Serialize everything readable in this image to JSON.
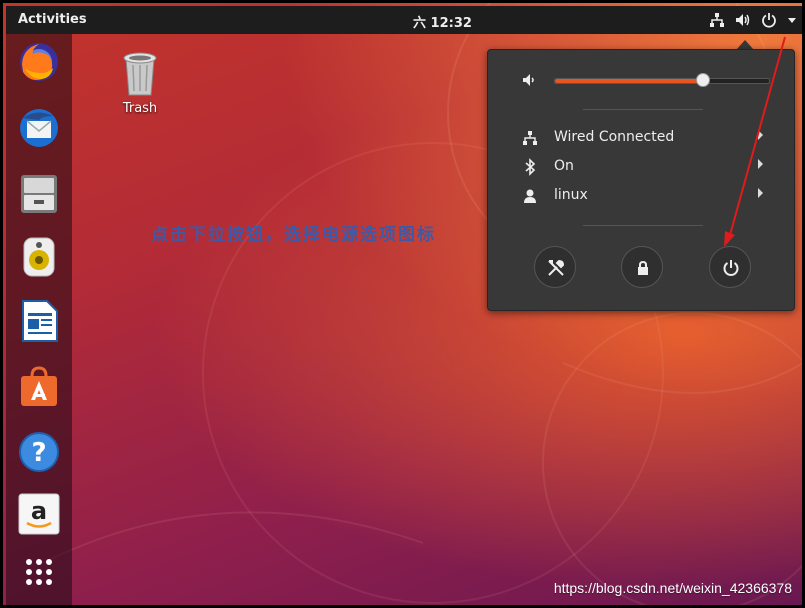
{
  "topbar": {
    "activities_label": "Activities",
    "clock": "六 12:32",
    "tray_icons": [
      "network-icon",
      "volume-icon",
      "power-icon",
      "dropdown-arrow-icon"
    ]
  },
  "dock": {
    "apps": [
      {
        "name": "Firefox",
        "icon": "firefox-icon"
      },
      {
        "name": "Thunderbird",
        "icon": "thunderbird-icon"
      },
      {
        "name": "Files",
        "icon": "files-icon"
      },
      {
        "name": "Rhythmbox",
        "icon": "rhythmbox-icon"
      },
      {
        "name": "LibreOffice Writer",
        "icon": "writer-icon"
      },
      {
        "name": "Ubuntu Software",
        "icon": "software-icon"
      },
      {
        "name": "Help",
        "icon": "help-icon"
      },
      {
        "name": "Amazon",
        "icon": "amazon-icon"
      },
      {
        "name": "Show Applications",
        "icon": "app-grid-icon"
      }
    ]
  },
  "desktop": {
    "trash_label": "Trash",
    "annotation_text": "点击下拉按钮，选择电源选项图标"
  },
  "system_menu": {
    "volume_level": 0.69,
    "items": [
      {
        "label": "Wired Connected",
        "icon": "wired-network-icon"
      },
      {
        "label": "On",
        "icon": "bluetooth-icon"
      },
      {
        "label": "linux",
        "icon": "user-icon"
      }
    ],
    "round_buttons": [
      "settings-icon",
      "lock-icon",
      "power-off-icon"
    ]
  },
  "watermark": "https://blog.csdn.net/weixin_42366378",
  "colors": {
    "accent": "#e95420",
    "panel_bg": "#383838",
    "topbar_bg": "#1d1d1d",
    "annotation_arrow": "#e01b1b",
    "annotation_text": "#3d5aa8"
  }
}
